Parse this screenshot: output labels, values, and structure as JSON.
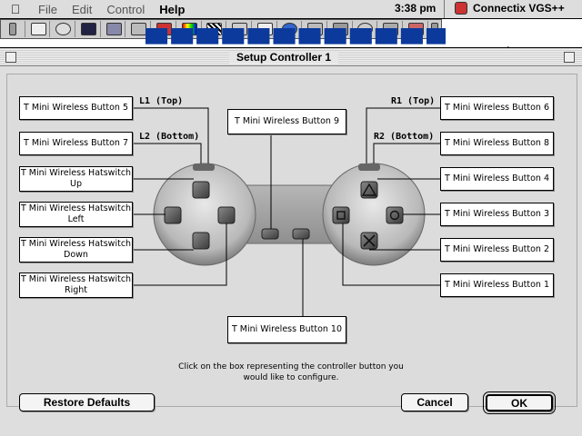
{
  "menubar": {
    "apple_glyph": "",
    "menus": [
      "File",
      "Edit",
      "Control",
      "Help"
    ],
    "clock": "3:38 pm",
    "app_name": "Connectix VGS++"
  },
  "dialog": {
    "title": "Setup Controller 1",
    "instruction": "Click on the box representing the controller button you would like to configure.",
    "restore_label": "Restore Defaults",
    "cancel_label": "Cancel",
    "ok_label": "OK"
  },
  "shoulder_tags": {
    "l1": "L1 (Top)",
    "l2": "L2 (Bottom)",
    "r1": "R1 (Top)",
    "r2": "R2 (Bottom)"
  },
  "mapping": {
    "l1": "T Mini Wireless Button 5",
    "l2": "T Mini Wireless Button 7",
    "up": "T Mini Wireless Hatswitch Up",
    "left": "T Mini Wireless Hatswitch Left",
    "down": "T Mini Wireless Hatswitch Down",
    "right": "T Mini Wireless Hatswitch Right",
    "select": "T Mini Wireless Button 9",
    "start": "T Mini Wireless Button 10",
    "r1": "T Mini Wireless Button 6",
    "r2": "T Mini Wireless Button 8",
    "triangle": "T Mini Wireless Button 4",
    "circle": "T Mini Wireless Button 3",
    "cross": "T Mini Wireless Button 2",
    "square": "T Mini Wireless Button 1"
  }
}
